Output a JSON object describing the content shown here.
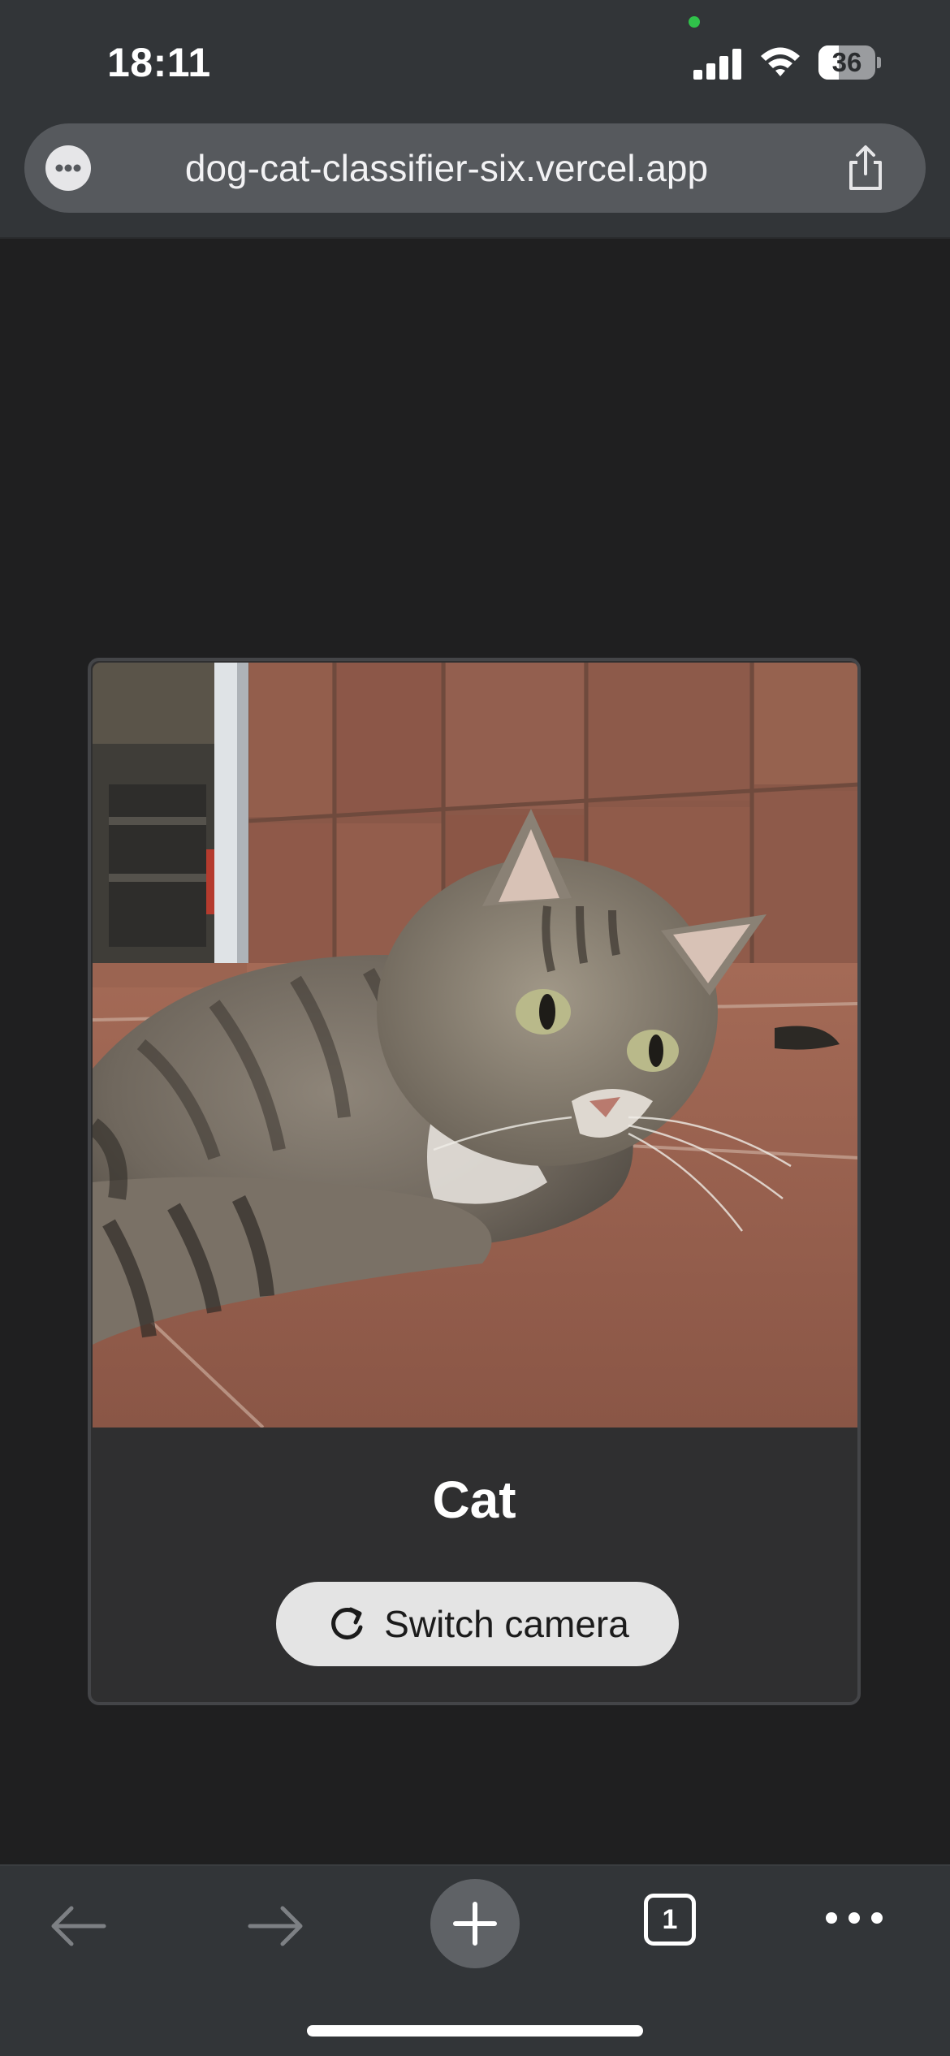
{
  "status_bar": {
    "time": "18:11",
    "battery_level": "36",
    "battery_fraction": 0.36,
    "signal_icon": "cellular-signal-icon",
    "wifi_icon": "wifi-icon",
    "camera_indicator_color": "#30c24a"
  },
  "browser": {
    "url": "dog-cat-classifier-six.vercel.app",
    "page_menu_icon": "more-horizontal-icon",
    "share_icon": "share-icon"
  },
  "classifier": {
    "camera_feed": "camera-feed-image",
    "prediction": "Cat",
    "switch_camera_label": "Switch camera",
    "switch_camera_icon": "refresh-icon"
  },
  "toolbar": {
    "back_icon": "arrow-left-icon",
    "forward_icon": "arrow-right-icon",
    "new_tab_icon": "plus-icon",
    "tab_count": "1",
    "menu_icon": "ellipsis-icon"
  },
  "colors": {
    "page_background": "#1f1f20",
    "chrome_background": "#323538",
    "card_background": "#2f2f30",
    "button_background": "#e4e4e4"
  }
}
